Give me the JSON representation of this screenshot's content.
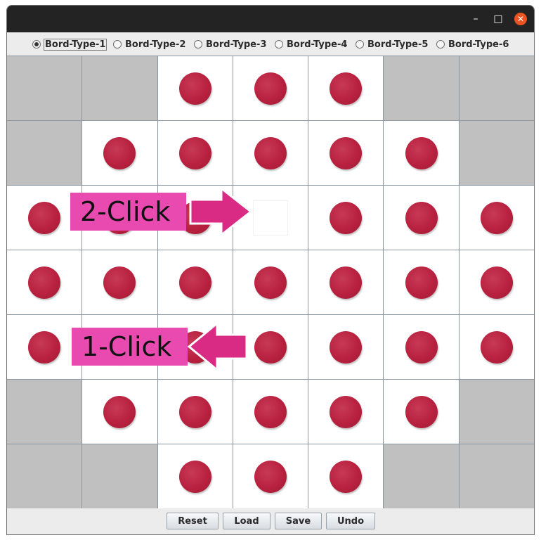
{
  "window": {
    "controls": {
      "minimize": "–",
      "maximize": "□",
      "close": "✕"
    }
  },
  "board_types": [
    {
      "label": "Bord-Type-1",
      "selected": true
    },
    {
      "label": "Bord-Type-2",
      "selected": false
    },
    {
      "label": "Bord-Type-3",
      "selected": false
    },
    {
      "label": "Bord-Type-4",
      "selected": false
    },
    {
      "label": "Bord-Type-5",
      "selected": false
    },
    {
      "label": "Bord-Type-6",
      "selected": false
    }
  ],
  "board": {
    "rows": [
      "--PPP--",
      "-PPPPP-",
      "PPPOPPP",
      "PPPPPPP",
      "PPPPPPP",
      "-PPPPP-",
      "--PPP--"
    ],
    "legend": {
      "-": "disabled",
      "P": "peg",
      "O": "empty"
    },
    "peg_color": "#b8213f",
    "disabled_color": "#c0c0c0"
  },
  "annotations": {
    "step2": "2-Click",
    "step1": "1-Click",
    "color": "#e84ab0"
  },
  "buttons": {
    "reset": "Reset",
    "load": "Load",
    "save": "Save",
    "undo": "Undo"
  }
}
